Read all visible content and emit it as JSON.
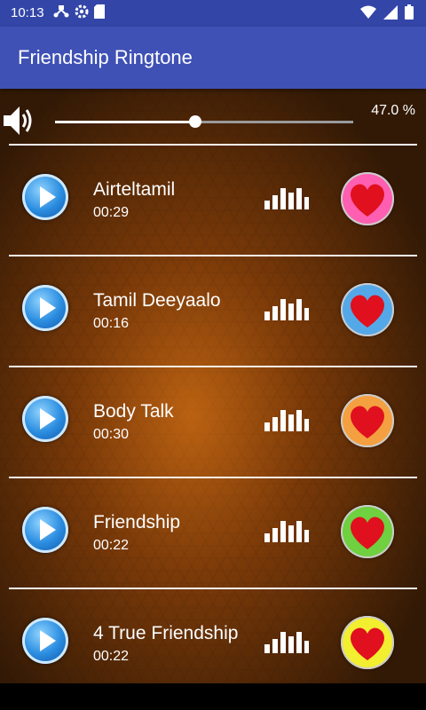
{
  "status": {
    "time": "10:13"
  },
  "app": {
    "title": "Friendship Ringtone"
  },
  "volume": {
    "level_percent": 47,
    "text": "47.0 %"
  },
  "songs": [
    {
      "title": "Airteltamil",
      "duration": "00:29",
      "heart_bg": "#ff5fb0"
    },
    {
      "title": "Tamil Deeyaalo",
      "duration": "00:16",
      "heart_bg": "#55a8e8"
    },
    {
      "title": "Body Talk",
      "duration": "00:30",
      "heart_bg": "#f5a040"
    },
    {
      "title": "Friendship",
      "duration": "00:22",
      "heart_bg": "#6fd040"
    },
    {
      "title": "4 True Friendship",
      "duration": "00:22",
      "heart_bg": "#f2ee30"
    }
  ],
  "colors": {
    "status_bar": "#3346a8",
    "app_bar": "#3f51b5",
    "heart": "#e0101e"
  }
}
